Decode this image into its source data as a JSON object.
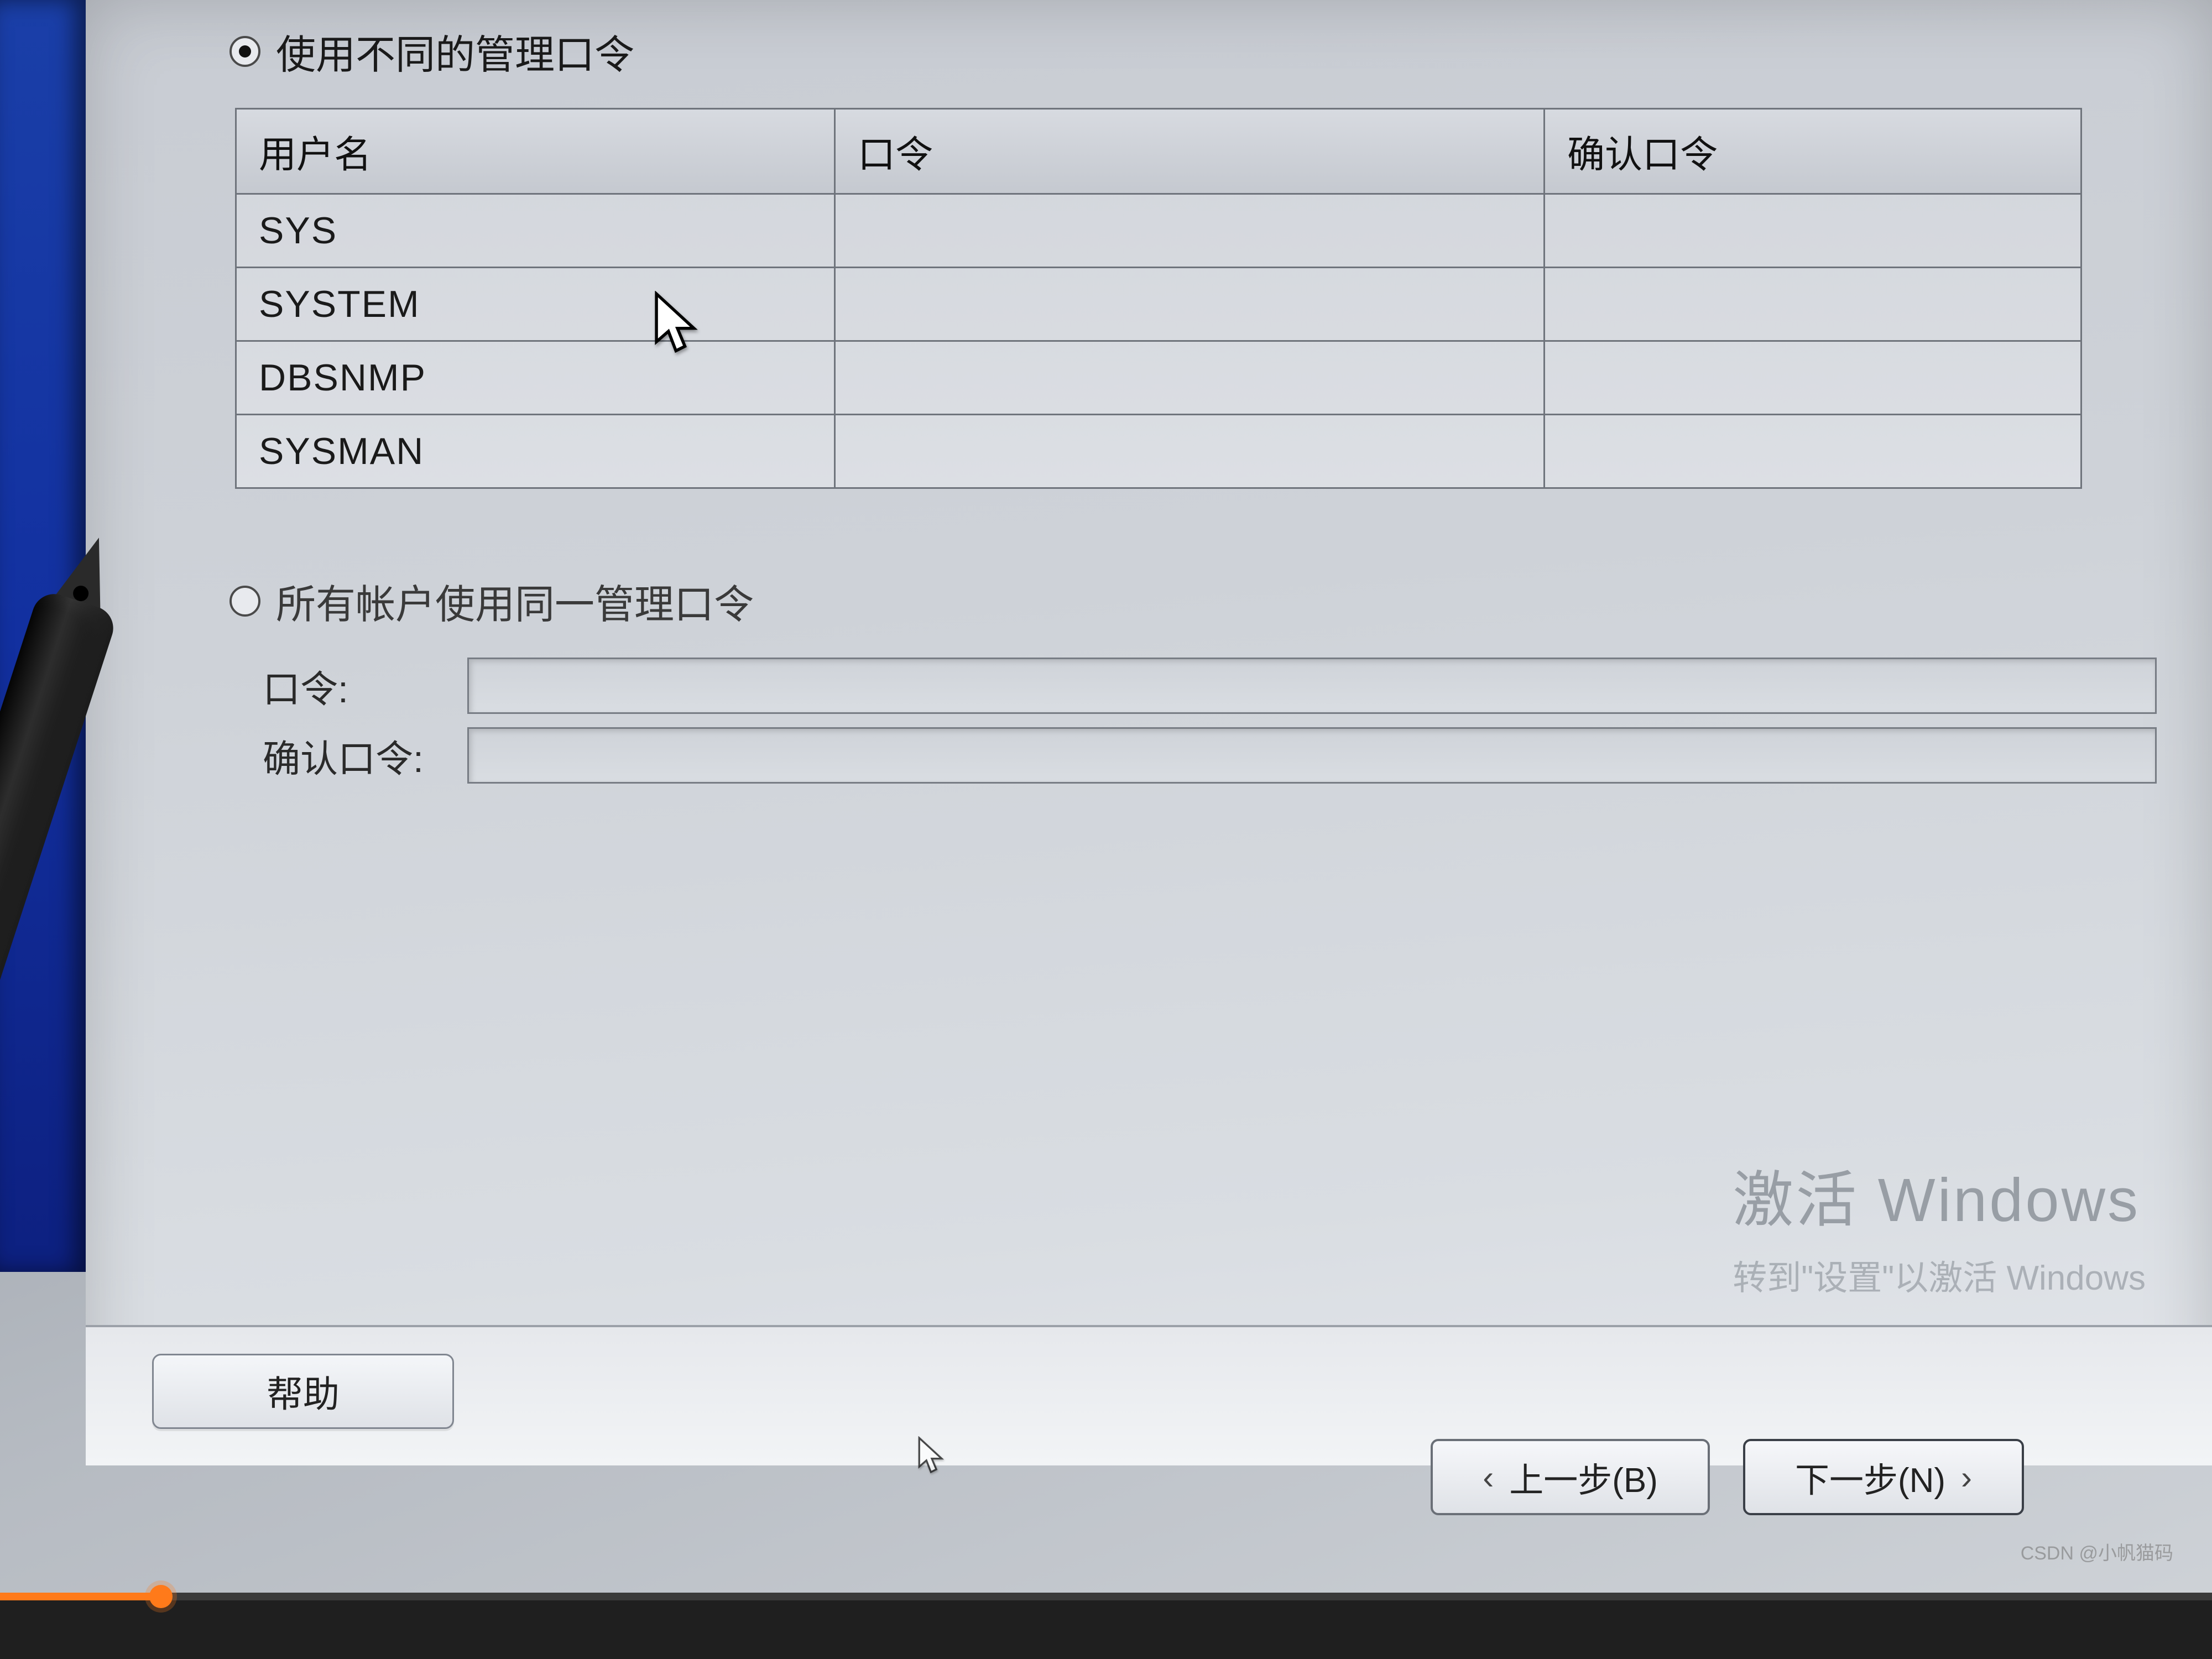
{
  "options": {
    "different_passwords_label": "使用不同的管理口令",
    "same_password_label": "所有帐户使用同一管理口令",
    "selected": "different"
  },
  "table": {
    "headers": {
      "username": "用户名",
      "password": "口令",
      "confirm": "确认口令"
    },
    "rows": [
      {
        "username": "SYS",
        "password": "",
        "confirm": ""
      },
      {
        "username": "SYSTEM",
        "password": "",
        "confirm": ""
      },
      {
        "username": "DBSNMP",
        "password": "",
        "confirm": ""
      },
      {
        "username": "SYSMAN",
        "password": "",
        "confirm": ""
      }
    ]
  },
  "same_password_fields": {
    "password_label": "口令:",
    "confirm_label": "确认口令:",
    "password_value": "",
    "confirm_value": ""
  },
  "buttons": {
    "help": "帮助",
    "back": "上一步(B)",
    "next": "下一步(N)"
  },
  "watermark": {
    "title": "激活 Windows",
    "subtitle": "转到\"设置\"以激活 Windows"
  },
  "csdn": "CSDN @小帆猫码"
}
